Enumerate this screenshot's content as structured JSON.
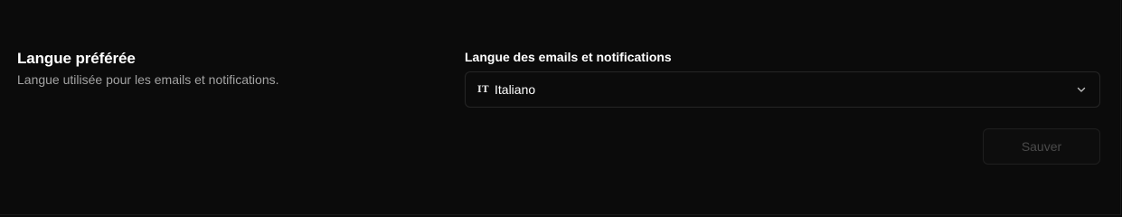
{
  "section": {
    "title": "Langue préférée",
    "description": "Langue utilisée pour les emails et notifications."
  },
  "language_field": {
    "label": "Langue des emails et notifications",
    "selected_code": "IT",
    "selected_value": "Italiano",
    "icon": "chevron-down-icon"
  },
  "actions": {
    "save_label": "Sauver",
    "save_disabled": true
  },
  "colors": {
    "background": "#0b0b0b",
    "border": "#262626",
    "text_primary": "#ffffff",
    "text_secondary": "#a3a3a3",
    "disabled_text": "#4a4a4a"
  }
}
